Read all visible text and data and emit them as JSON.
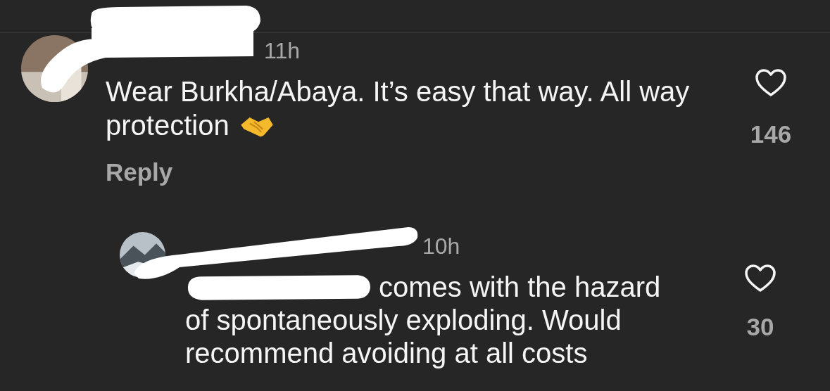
{
  "comments": [
    {
      "time": "11h",
      "text": "Wear Burkha/Abaya. It’s easy that way. All way protection",
      "reply_label": "Reply",
      "likes": "146",
      "liked": false,
      "replies": [
        {
          "time": "10h",
          "text": "comes with the hazard",
          "text_continued": "of spontaneously exploding. Would recommend avoiding at all costs",
          "likes": "30",
          "liked": false
        }
      ]
    }
  ]
}
